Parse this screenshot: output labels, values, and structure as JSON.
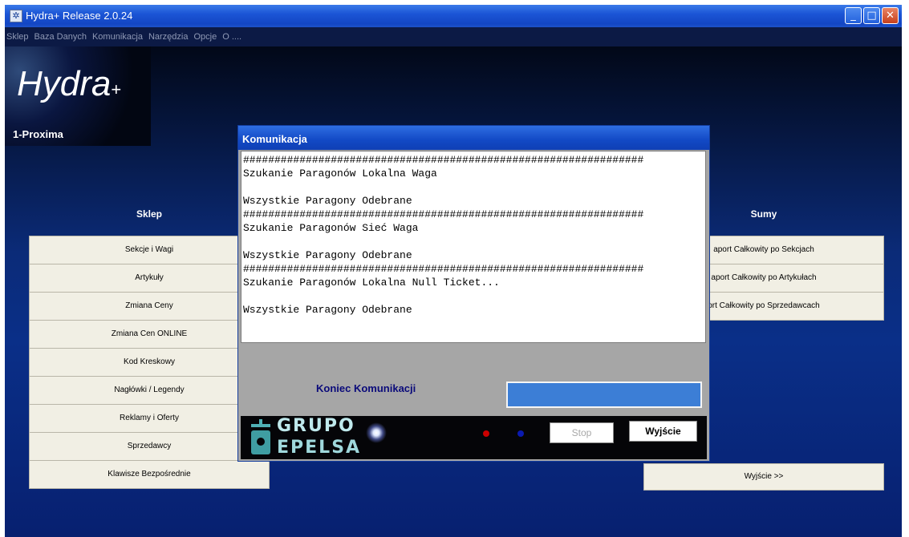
{
  "window": {
    "title": "Hydra+ Release 2.0.24",
    "controls": {
      "minimize": "_",
      "maximize": "□",
      "close": "✕"
    }
  },
  "menu": [
    "Sklep",
    "Baza Danych",
    "Komunikacja",
    "Narzędzia",
    "Opcje",
    "O ...."
  ],
  "logo": {
    "name": "Hydra",
    "plus": "+",
    "store": "1-Proxima"
  },
  "sklep": {
    "heading": "Sklep",
    "buttons": [
      "Sekcje i Wagi",
      "Artykuły",
      "Zmiana Ceny",
      "Zmiana Cen ONLINE",
      "Kod Kreskowy",
      "Nagłówki / Legendy",
      "Reklamy i Oferty",
      "Sprzedawcy",
      "Klawisze Bezpośrednie"
    ]
  },
  "sumy": {
    "heading": "Sumy",
    "buttons": [
      "aport Całkowity po Sekcjach",
      "aport Całkowity po Artykułach",
      "ort Całkowity po Sprzedawcach"
    ],
    "exit": "Wyjście >>"
  },
  "dialog": {
    "title": "Komunikacja",
    "log": [
      "################################################################",
      "Szukanie Paragonów Lokalna Waga",
      "",
      "Wszystkie Paragony Odebrane",
      "################################################################",
      "Szukanie Paragonów Sieć Waga",
      "",
      "Wszystkie Paragony Odebrane",
      "################################################################",
      "Szukanie Paragonów Lokalna Null Ticket...",
      "",
      "Wszystkie Paragony Odebrane"
    ],
    "status": "Koniec Komunikacji",
    "brand_line1": "GRUPO",
    "brand_line2": "EPELSA",
    "led_colors": [
      "#cc0000",
      "#0a1ab0"
    ],
    "stop_label": "Stop",
    "exit_label": "Wyjście"
  }
}
